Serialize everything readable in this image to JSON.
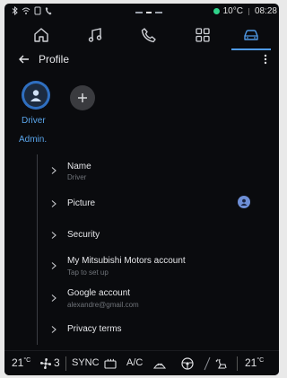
{
  "status": {
    "temperature": "10°C",
    "time": "08:28",
    "icons": [
      "bluetooth-icon",
      "wifi-icon",
      "notification-icon",
      "phone-icon"
    ]
  },
  "nav": {
    "tabs": [
      {
        "name": "home",
        "icon": "home-icon",
        "active": false
      },
      {
        "name": "music",
        "icon": "music-icon",
        "active": false
      },
      {
        "name": "phone",
        "icon": "phone-icon",
        "active": false
      },
      {
        "name": "apps",
        "icon": "apps-icon",
        "active": false
      },
      {
        "name": "vehicle",
        "icon": "car-icon",
        "active": true
      }
    ]
  },
  "header": {
    "title": "Profile"
  },
  "profile": {
    "driver_name": "Driver",
    "driver_role": "Admin."
  },
  "settings": {
    "name": {
      "label": "Name",
      "value": "Driver"
    },
    "picture": {
      "label": "Picture"
    },
    "security": {
      "label": "Security"
    },
    "mitsubishi": {
      "label": "My Mitsubishi Motors account",
      "value": "Tap to set up"
    },
    "google": {
      "label": "Google account",
      "value": "alexandre@gmail.com"
    },
    "privacy": {
      "label": "Privacy terms"
    }
  },
  "climate": {
    "left_temp": "21",
    "right_temp": "21",
    "temp_unit": "°C",
    "fan_level": "3",
    "sync_label": "SYNC",
    "ac_label": "A/C"
  },
  "colors": {
    "accent": "#4f9ae6",
    "driver_avatar": "#2f6fc0",
    "eco_leaf": "#2fd38a",
    "background": "#0a0b0e"
  }
}
